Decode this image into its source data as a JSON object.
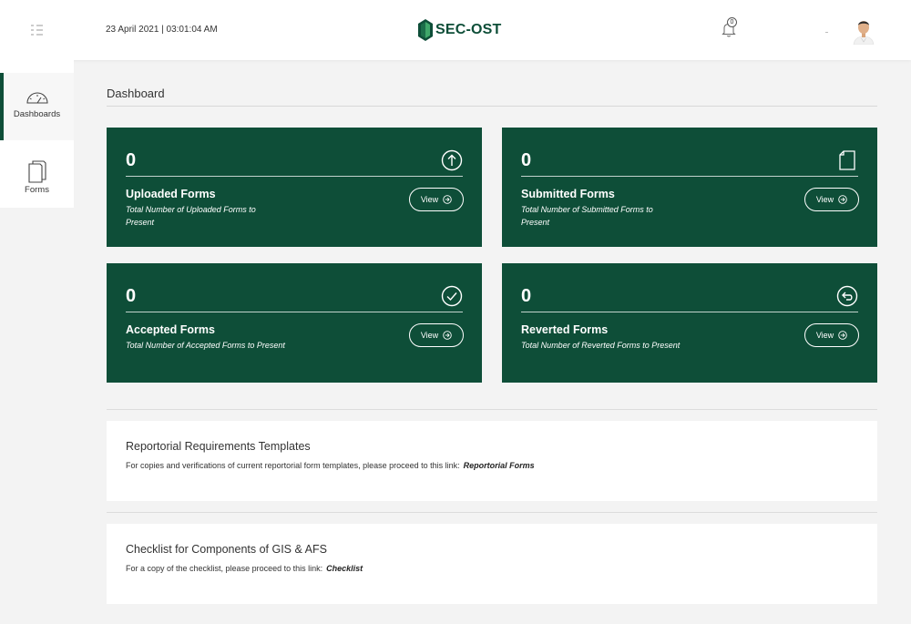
{
  "header": {
    "datetime": "23 April 2021 | 03:01:04 AM",
    "logo_text": "SEC-OST",
    "notification_count": "0"
  },
  "sidebar": {
    "items": [
      {
        "label": "Dashboards",
        "icon": "speedometer-icon",
        "active": true
      },
      {
        "label": "Forms",
        "icon": "documents-icon",
        "active": false
      }
    ]
  },
  "main": {
    "title": "Dashboard",
    "cards": [
      {
        "count": "0",
        "title": "Uploaded Forms",
        "description": "Total Number of Uploaded Forms to Present",
        "icon": "upload-circle-icon",
        "button": "View"
      },
      {
        "count": "0",
        "title": "Submitted Forms",
        "description": "Total Number of Submitted Forms to Present",
        "icon": "document-icon",
        "button": "View"
      },
      {
        "count": "0",
        "title": "Accepted Forms",
        "description": "Total Number of Accepted Forms to Present",
        "icon": "check-circle-icon",
        "button": "View"
      },
      {
        "count": "0",
        "title": "Reverted Forms",
        "description": "Total Number of Reverted Forms to Present",
        "icon": "revert-circle-icon",
        "button": "View"
      }
    ],
    "panels": [
      {
        "title": "Reportorial Requirements Templates",
        "text": "For copies and verifications of current reportorial form templates, please proceed to this link:",
        "link": "Reportorial Forms"
      },
      {
        "title": "Checklist for Components of GIS & AFS",
        "text": "For a copy of the checklist, please proceed to this link:",
        "link": "Checklist"
      }
    ]
  },
  "colors": {
    "brand_green": "#0e4e38",
    "background": "#f3f3f3"
  }
}
